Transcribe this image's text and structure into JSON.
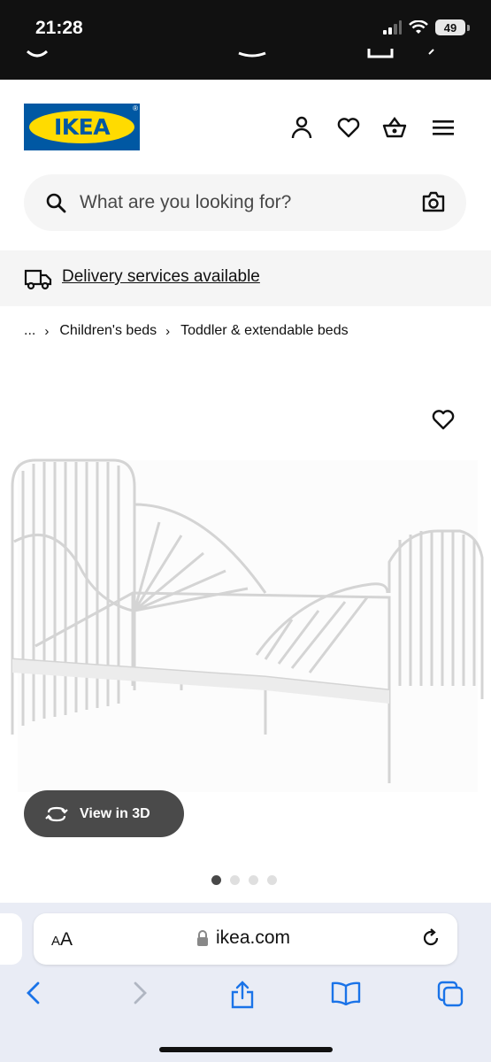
{
  "status_bar": {
    "time": "21:28",
    "battery": "49"
  },
  "header": {
    "logo_text": "IKEA",
    "logo_colors": {
      "blue": "#0058a3",
      "yellow": "#ffdb00"
    },
    "icons": [
      "profile-icon",
      "heart-icon",
      "basket-icon",
      "menu-icon"
    ]
  },
  "search": {
    "placeholder": "What are you looking for?"
  },
  "delivery": {
    "label": "Delivery services available"
  },
  "breadcrumb": {
    "ellipsis": "...",
    "items": [
      "Children's beds",
      "Toddler & extendable beds"
    ]
  },
  "product": {
    "view3d_label": "View in 3D",
    "image_count": 4,
    "active_image": 1
  },
  "browser": {
    "aa_big": "A",
    "aa_small": "A",
    "url": "ikea.com"
  }
}
